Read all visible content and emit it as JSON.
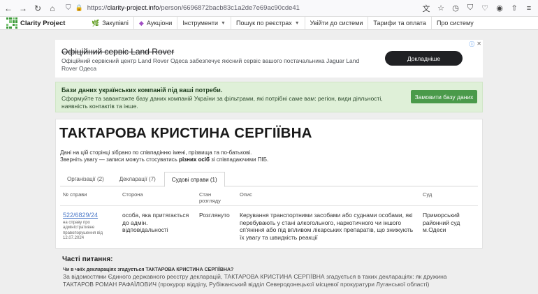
{
  "browser": {
    "back": "←",
    "forward": "→",
    "reload": "↻",
    "home": "⌂",
    "url_prefix": "https://",
    "url_host": "clarity-project.info",
    "url_path": "/person/6696872bacb83c1a2de7e69ac90cde41"
  },
  "nav": {
    "logo_text": "Clarity Project",
    "items": [
      {
        "label": "Закупівлі",
        "icon": "🌿"
      },
      {
        "label": "Аукціони",
        "icon": "◆"
      },
      {
        "label": "Інструменти",
        "caret": "▼"
      },
      {
        "label": "Пошук по реєстрах",
        "caret": "▼"
      },
      {
        "label": "Увійти до системи"
      },
      {
        "label": "Тарифи та оплата"
      },
      {
        "label": "Про систему"
      }
    ]
  },
  "ad": {
    "title": "Офіційний сервіс Land Rover",
    "text": "Офіційний сервісний центр Land Rover Одеса забезпечує якісний сервіс вашого постачальника Jaguar Land Rover Одеса",
    "button": "Докладніше",
    "info_icon": "ⓘ",
    "close_icon": "✕"
  },
  "promo": {
    "title": "Бази даних українських компаній під ваші потреби.",
    "text": "Сформуйте та завантажте базу даних компаній України за фільтрами, які потрібні саме вам: регіон, види діяльності, наявність контактів та інше.",
    "button": "Замовити базу даних"
  },
  "person": {
    "name": "ТАКТАРОВА КРИСТИНА СЕРГІЇВНА",
    "note_line1": "Дані на цій сторінці зібрано по співпадінню імені, прізвища та по-батькові.",
    "note_line2_pre": "Зверніть увагу — записи можуть стосуватись ",
    "note_line2_bold": "різних осіб",
    "note_line2_post": " зі співпадаючими ПІБ."
  },
  "tabs": [
    {
      "label": "Організації (2)",
      "active": false
    },
    {
      "label": "Декларації (7)",
      "active": false
    },
    {
      "label": "Судові справи (1)",
      "active": true
    }
  ],
  "table": {
    "headers": {
      "case_no": "№ справи",
      "party": "Сторона",
      "status": "Стан розгляду",
      "description": "Опис",
      "court": "Суд"
    },
    "row": {
      "case_no": "522/6829/24",
      "case_sub": "на справу про адміністративне правопорушення від 12.07.2024",
      "party": "особа, яка притягається до адмін. відповідальності",
      "status": "Розглянуто",
      "description": "Керування транспортними засобами або суднами особами, які перебувають у стані алкогольного, наркотичного чи іншого сп'яніння або під впливом лікарських препаратів, що знижують їх увагу та швидкість реакції",
      "court": "Приморський районний суд м.Одеси"
    }
  },
  "faq": {
    "title": "Часті питання:",
    "question": "Чи в чиїх деклараціях згадується ТАКТАРОВА КРИСТИНА СЕРГІЇВНА?",
    "answer": "За відомостями Єдиного державного реєстру декларацій, ТАКТАРОВА КРИСТИНА СЕРГІЇВНА згадується в таких деклараціях: як дружина ТАКТАРОВ РОМАН РАФАЇЛОВИЧ (прокурор відділу, Рубіжанський відділ Северодонецької місцевої прокуратури Луганської області)"
  }
}
